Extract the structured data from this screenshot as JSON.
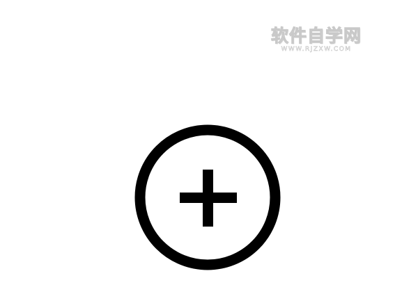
{
  "watermark": {
    "title": "软件自学网",
    "url": "WWW.RJZXW.COM"
  },
  "add_button": {
    "icon": "plus-circle-icon",
    "color": "#000000"
  },
  "colors": {
    "background": "#ffffff",
    "watermark_outline": "#c9c9c9"
  }
}
